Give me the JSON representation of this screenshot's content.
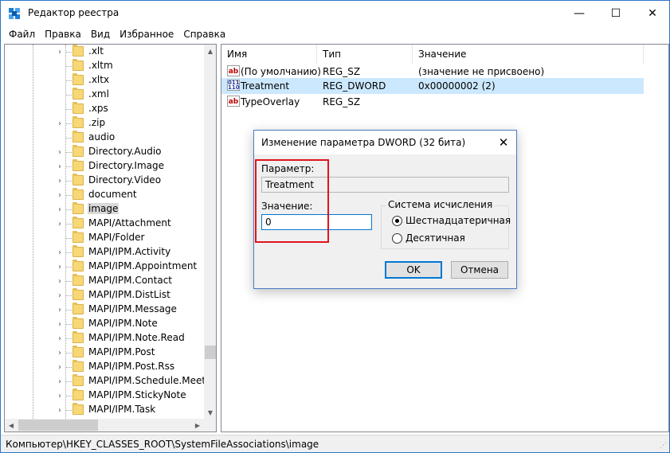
{
  "window": {
    "title": "Редактор реестра",
    "minimize": "—",
    "maximize": "☐",
    "close": "✕"
  },
  "menu": [
    "Файл",
    "Правка",
    "Вид",
    "Избранное",
    "Справка"
  ],
  "tree": {
    "items": [
      {
        "label": ".xlt",
        "expander": "›"
      },
      {
        "label": ".xltm",
        "expander": ""
      },
      {
        "label": ".xltx",
        "expander": ""
      },
      {
        "label": ".xml",
        "expander": ""
      },
      {
        "label": ".xps",
        "expander": ""
      },
      {
        "label": ".zip",
        "expander": "›"
      },
      {
        "label": "audio",
        "expander": ""
      },
      {
        "label": "Directory.Audio",
        "expander": "›"
      },
      {
        "label": "Directory.Image",
        "expander": "›"
      },
      {
        "label": "Directory.Video",
        "expander": "›"
      },
      {
        "label": "document",
        "expander": "›"
      },
      {
        "label": "image",
        "expander": "›",
        "selected": true
      },
      {
        "label": "MAPI/Attachment",
        "expander": "›"
      },
      {
        "label": "MAPI/Folder",
        "expander": ""
      },
      {
        "label": "MAPI/IPM.Activity",
        "expander": "›"
      },
      {
        "label": "MAPI/IPM.Appointment",
        "expander": "›"
      },
      {
        "label": "MAPI/IPM.Contact",
        "expander": "›"
      },
      {
        "label": "MAPI/IPM.DistList",
        "expander": "›"
      },
      {
        "label": "MAPI/IPM.Message",
        "expander": "›"
      },
      {
        "label": "MAPI/IPM.Note",
        "expander": "›"
      },
      {
        "label": "MAPI/IPM.Note.Read",
        "expander": "›"
      },
      {
        "label": "MAPI/IPM.Post",
        "expander": "›"
      },
      {
        "label": "MAPI/IPM.Post.Rss",
        "expander": "›"
      },
      {
        "label": "MAPI/IPM.Schedule.Meeting",
        "expander": "›"
      },
      {
        "label": "MAPI/IPM.StickyNote",
        "expander": "›"
      },
      {
        "label": "MAPI/IPM.Task",
        "expander": "›"
      }
    ]
  },
  "values": {
    "headers": {
      "name": "Имя",
      "type": "Тип",
      "data": "Значение"
    },
    "rows": [
      {
        "icon": "ab",
        "name": "(По умолчанию)",
        "type": "REG_SZ",
        "data": "(значение не присвоено)",
        "selected": false
      },
      {
        "icon": "bin",
        "name": "Treatment",
        "type": "REG_DWORD",
        "data": "0x00000002 (2)",
        "selected": true
      },
      {
        "icon": "ab",
        "name": "TypeOverlay",
        "type": "REG_SZ",
        "data": "",
        "selected": false
      }
    ]
  },
  "status": {
    "path": "Компьютер\\HKEY_CLASSES_ROOT\\SystemFileAssociations\\image"
  },
  "dialog": {
    "title": "Изменение параметра DWORD (32 бита)",
    "close": "✕",
    "name_label": "Параметр:",
    "name_value": "Treatment",
    "value_label": "Значение:",
    "value_value": "0",
    "base_group": "Система исчисления",
    "radio_hex": "Шестнадцатеричная",
    "radio_dec": "Десятичная",
    "radio_hex_checked": true,
    "ok": "OK",
    "cancel": "Отмена"
  },
  "accent": {
    "annotation": "#e0141e",
    "selection": "#cce8ff",
    "focus": "#0078d7"
  }
}
